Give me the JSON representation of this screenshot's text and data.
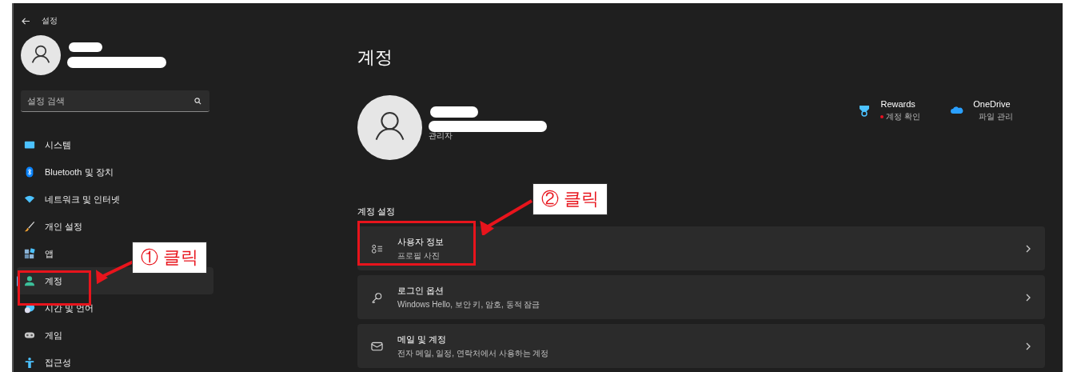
{
  "window": {
    "title": "설정"
  },
  "sidebar": {
    "search": {
      "placeholder": "설정 검색"
    },
    "items": [
      {
        "label": "시스템",
        "selected": false
      },
      {
        "label": "Bluetooth 및 장치",
        "selected": false
      },
      {
        "label": "네트워크 및 인터넷",
        "selected": false
      },
      {
        "label": "개인 설정",
        "selected": false
      },
      {
        "label": "앱",
        "selected": false
      },
      {
        "label": "계정",
        "selected": true
      },
      {
        "label": "시간 및 언어",
        "selected": false
      },
      {
        "label": "게임",
        "selected": false
      },
      {
        "label": "접근성",
        "selected": false
      }
    ]
  },
  "main": {
    "title": "계정",
    "profile": {
      "role": "관리자"
    },
    "services": [
      {
        "name": "Rewards",
        "status": "계정 확인",
        "alert": true
      },
      {
        "name": "OneDrive",
        "status": "파일 관리",
        "alert": false
      }
    ],
    "section_title": "계정 설정",
    "cards": [
      {
        "title": "사용자 정보",
        "subtitle": "프로필 사진"
      },
      {
        "title": "로그인 옵션",
        "subtitle": "Windows Hello, 보안 키, 암호, 동적 잠금"
      },
      {
        "title": "메일 및 계정",
        "subtitle": "전자 메일, 일정, 연락처에서 사용하는 계정"
      }
    ]
  },
  "annotations": [
    {
      "label": "① 클릭"
    },
    {
      "label": "② 클릭"
    }
  ]
}
